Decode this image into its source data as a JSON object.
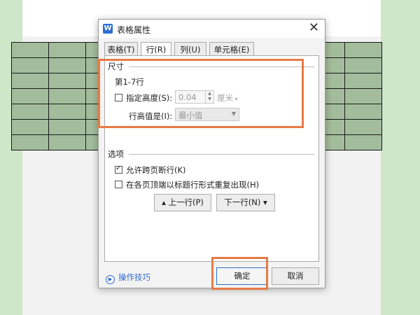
{
  "dialog": {
    "title": "表格属性",
    "app_icon": "W",
    "close_label": "✕",
    "icons": {
      "app": "wps-writer-icon",
      "close": "close-icon",
      "help": "play-circle-icon"
    }
  },
  "tabs": [
    {
      "label": "表格(T)",
      "active": false
    },
    {
      "label": "行(R)",
      "active": true
    },
    {
      "label": "列(U)",
      "active": false
    },
    {
      "label": "单元格(E)",
      "active": false
    }
  ],
  "size_group": {
    "title": "尺寸",
    "row_range": "第1-7行",
    "specify_height_label": "指定高度(S):",
    "specify_height_checked": false,
    "height_value": "0.04",
    "unit": "厘米",
    "row_height_label": "行高值是(I):",
    "row_height_value": "最小值"
  },
  "options_group": {
    "title": "选项",
    "allow_break_label": "允许跨页断行(K)",
    "allow_break_checked": true,
    "repeat_header_label": "在各页顶端以标题行形式重复出现(H)",
    "repeat_header_checked": false
  },
  "nav": {
    "prev_row": "▴ 上一行(P)",
    "next_row": "下一行(N) ▾"
  },
  "footer": {
    "tips": "操作技巧",
    "ok": "确定",
    "cancel": "取消"
  },
  "colors": {
    "accent_highlight": "#e87a45",
    "primary_border": "#2e73c9",
    "link": "#2f6ccf",
    "table_fill": "#a3bd9c",
    "background": "#cfe6c9"
  }
}
